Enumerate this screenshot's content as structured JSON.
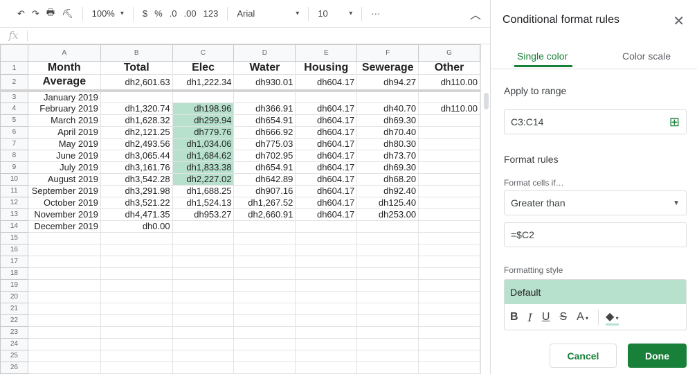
{
  "toolbar": {
    "zoom": "100%",
    "currency": "$",
    "percent": "%",
    "dec_less": ".0",
    "dec_more": ".00",
    "more_formats": "123",
    "font": "Arial",
    "font_size": "10",
    "more": "···"
  },
  "formula_bar": {
    "fx": "fx",
    "value": ""
  },
  "columns": [
    "A",
    "B",
    "C",
    "D",
    "E",
    "F",
    "G"
  ],
  "header_row": [
    "Month",
    "Total",
    "Elec",
    "Water",
    "Housing",
    "Sewerage",
    "Other"
  ],
  "average_row": [
    "Average",
    "dh2,601.63",
    "dh1,222.34",
    "dh930.01",
    "dh604.17",
    "dh94.27",
    "dh110.00"
  ],
  "rows": [
    [
      "January 2019",
      "",
      "",
      "",
      "",
      "",
      ""
    ],
    [
      "February 2019",
      "dh1,320.74",
      "dh198.96",
      "dh366.91",
      "dh604.17",
      "dh40.70",
      "dh110.00"
    ],
    [
      "March 2019",
      "dh1,628.32",
      "dh299.94",
      "dh654.91",
      "dh604.17",
      "dh69.30",
      ""
    ],
    [
      "April 2019",
      "dh2,121.25",
      "dh779.76",
      "dh666.92",
      "dh604.17",
      "dh70.40",
      ""
    ],
    [
      "May 2019",
      "dh2,493.56",
      "dh1,034.06",
      "dh775.03",
      "dh604.17",
      "dh80.30",
      ""
    ],
    [
      "June 2019",
      "dh3,065.44",
      "dh1,684.62",
      "dh702.95",
      "dh604.17",
      "dh73.70",
      ""
    ],
    [
      "July 2019",
      "dh3,161.76",
      "dh1,833.38",
      "dh654.91",
      "dh604.17",
      "dh69.30",
      ""
    ],
    [
      "August 2019",
      "dh3,542.28",
      "dh2,227.02",
      "dh642.89",
      "dh604.17",
      "dh68.20",
      ""
    ],
    [
      "September 2019",
      "dh3,291.98",
      "dh1,688.25",
      "dh907.16",
      "dh604.17",
      "dh92.40",
      ""
    ],
    [
      "October 2019",
      "dh3,521.22",
      "dh1,524.13",
      "dh1,267.52",
      "dh604.17",
      "dh125.40",
      ""
    ],
    [
      "November 2019",
      "dh4,471.35",
      "dh953.27",
      "dh2,660.91",
      "dh604.17",
      "dh253.00",
      ""
    ],
    [
      "December 2019",
      "dh0.00",
      "",
      "",
      "",
      "",
      ""
    ]
  ],
  "highlighted_rows": [
    4,
    5,
    6,
    7,
    8,
    9,
    10
  ],
  "total_rows": 26,
  "panel": {
    "title": "Conditional format rules",
    "tabs": [
      "Single color",
      "Color scale"
    ],
    "apply_label": "Apply to range",
    "range": "C3:C14",
    "rules_label": "Format rules",
    "cells_if": "Format cells if…",
    "condition": "Greater than",
    "value": "=$C2",
    "style_label": "Formatting style",
    "style_value": "Default",
    "cancel": "Cancel",
    "done": "Done"
  },
  "colors": {
    "accent": "#188038",
    "highlight": "#b7e1cd"
  }
}
